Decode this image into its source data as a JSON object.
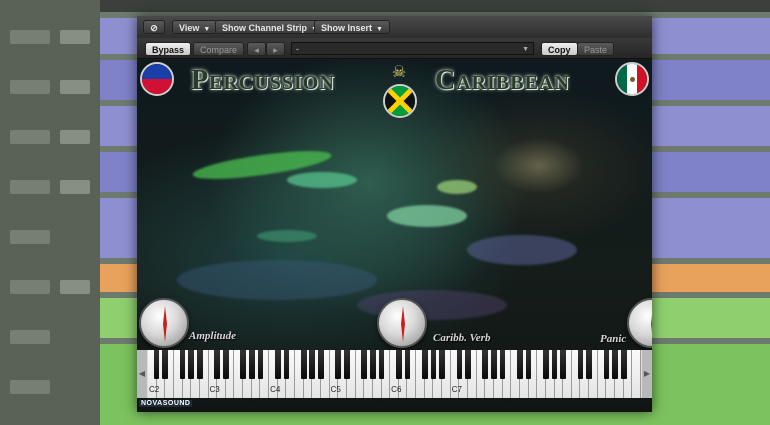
{
  "toolbar": {
    "link_icon": "link-icon",
    "view_label": "View",
    "channel_strip_label": "Show Channel Strip",
    "insert_label": "Show Insert",
    "bypass_label": "Bypass",
    "compare_label": "Compare",
    "prev_icon": "◂",
    "next_icon": "▸",
    "preset_value": "-",
    "copy_label": "Copy",
    "paste_label": "Paste"
  },
  "instrument": {
    "title_left": "Percussion",
    "title_right": "Caribbean",
    "knobs": [
      {
        "label": "Amplitude"
      },
      {
        "label": "Caribb. Verb"
      },
      {
        "label": "Panic"
      }
    ],
    "octaves": [
      "C2",
      "C3",
      "C4",
      "C5",
      "C6",
      "C7"
    ],
    "logo_text": "NOVASOUND"
  },
  "colors": {
    "accent_red": "#d42a2a",
    "flag_haiti_blue": "#1a3fa8",
    "flag_haiti_red": "#d21034",
    "flag_jamaica_green": "#009b3a",
    "flag_jamaica_gold": "#fed100",
    "flag_mexico_green": "#006847",
    "flag_mexico_red": "#ce1126"
  }
}
